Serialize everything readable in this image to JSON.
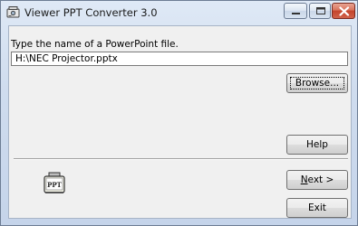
{
  "window": {
    "title": "Viewer PPT Converter 3.0",
    "icon": "projector-app-icon",
    "controls": {
      "minimize": "minimize-icon",
      "maximize": "maximize-icon",
      "close": "close-icon"
    }
  },
  "form": {
    "prompt_label": "Type the name of a PowerPoint file.",
    "filename_value": "H:\\NEC Projector.pptx"
  },
  "buttons": {
    "browse": "Browse...",
    "help": "Help",
    "next_mnemonic": "N",
    "next_rest": "ext >",
    "exit": "Exit"
  },
  "decor": {
    "ppt_icon_label": "PPT"
  },
  "colors": {
    "close_button": "#c3442c",
    "window_frame": "#cfdcee",
    "client_background": "#f0f0f0"
  }
}
